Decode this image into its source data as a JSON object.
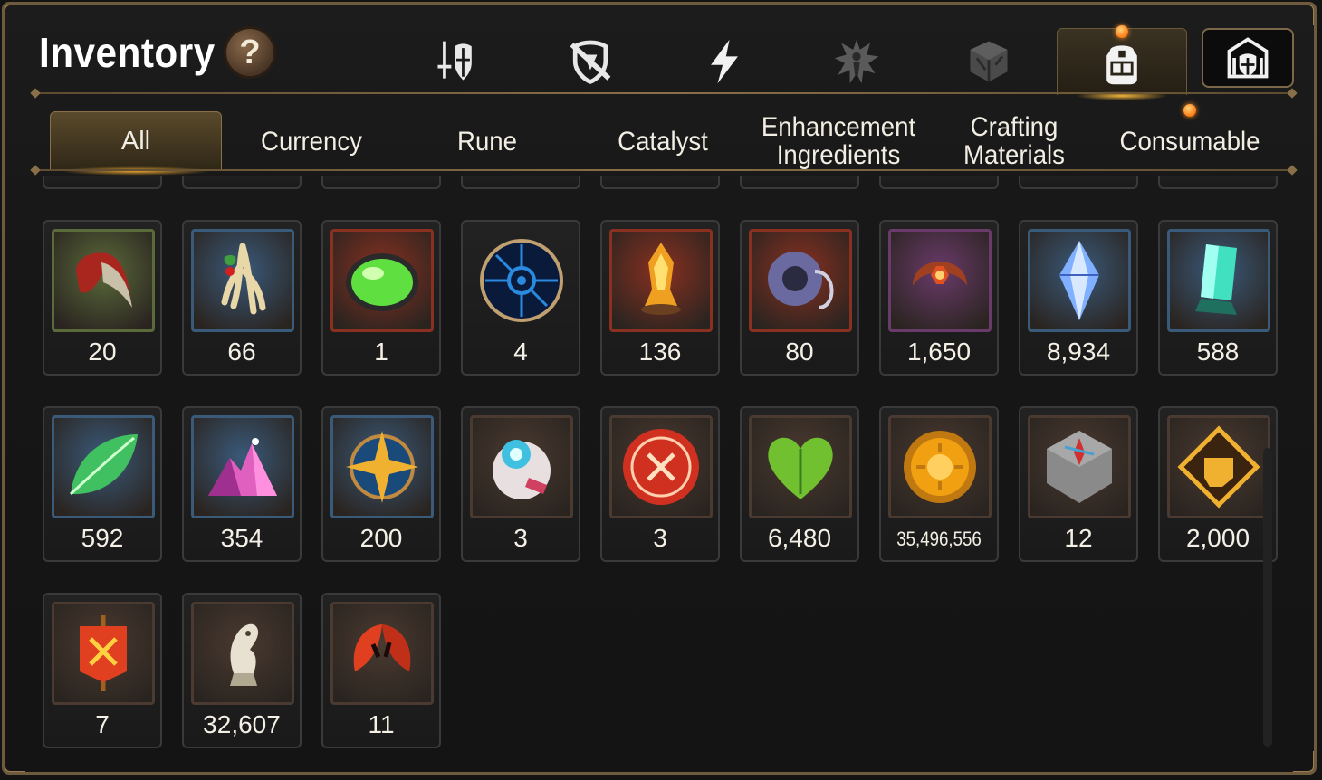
{
  "header": {
    "title": "Inventory",
    "help_label": "?"
  },
  "category_tabs": [
    {
      "icon": "sword-shield-icon",
      "active": false
    },
    {
      "icon": "broken-shield-icon",
      "active": false
    },
    {
      "icon": "lightning-icon",
      "active": false
    },
    {
      "icon": "splat-figure-icon",
      "active": false
    },
    {
      "icon": "cube-icon",
      "active": false
    },
    {
      "icon": "backpack-icon",
      "active": true
    },
    {
      "icon": "castle-shield-icon",
      "active": false
    }
  ],
  "sub_tabs": [
    {
      "label": "All",
      "active": true
    },
    {
      "label": "Currency",
      "active": false
    },
    {
      "label": "Rune",
      "active": false
    },
    {
      "label": "Catalyst",
      "active": false
    },
    {
      "label": "Enhancement Ingredients",
      "active": false
    },
    {
      "label": "Crafting Materials",
      "active": false
    },
    {
      "label": "Consumable",
      "active": false
    }
  ],
  "items": [
    {
      "icon": "claw-icon",
      "quantity": "20",
      "frame": "#5a6a3a",
      "color": "#c8c0a8"
    },
    {
      "icon": "root-herb-icon",
      "quantity": "66",
      "frame": "#3a5a7a",
      "color": "#e8d8a8"
    },
    {
      "icon": "green-orb-icon",
      "quantity": "1",
      "frame": "#8a3020",
      "color": "#60e040"
    },
    {
      "icon": "blue-rune-disc-icon",
      "quantity": "4",
      "frame": "round",
      "color": "#2a8ae0"
    },
    {
      "icon": "flame-crystal-icon",
      "quantity": "136",
      "frame": "#8a3020",
      "color": "#f0a020"
    },
    {
      "icon": "ring-charm-icon",
      "quantity": "80",
      "frame": "#8a3020",
      "color": "#6a6aa0"
    },
    {
      "icon": "crescent-flower-icon",
      "quantity": "1,650",
      "frame": "#6a3a6a",
      "color": "#e05020"
    },
    {
      "icon": "blue-crystal-icon",
      "quantity": "8,934",
      "frame": "#3a5a7a",
      "color": "#80b0ff"
    },
    {
      "icon": "teal-crystal-icon",
      "quantity": "588",
      "frame": "#3a5a7a",
      "color": "#40e0c0"
    },
    {
      "icon": "green-leaf-icon",
      "quantity": "592",
      "frame": "#3a5a7a",
      "color": "#40c060"
    },
    {
      "icon": "pink-crystal-pile-icon",
      "quantity": "354",
      "frame": "#3a5a7a",
      "color": "#e060c0"
    },
    {
      "icon": "star-compass-icon",
      "quantity": "200",
      "frame": "#3a5a7a",
      "color": "#f0b030"
    },
    {
      "icon": "orb-device-icon",
      "quantity": "3",
      "frame": "#4a3a30",
      "color": "#40c0e0"
    },
    {
      "icon": "red-badge-icon",
      "quantity": "3",
      "frame": "#4a3a30",
      "color": "#d03020"
    },
    {
      "icon": "green-heart-icon",
      "quantity": "6,480",
      "frame": "#4a3a30",
      "color": "#70c030"
    },
    {
      "icon": "gold-coin-icon",
      "quantity": "35,496,556",
      "frame": "#4a3a30",
      "color": "#f0a010"
    },
    {
      "icon": "stone-compass-icon",
      "quantity": "12",
      "frame": "#4a3a30",
      "color": "#8a8a8a"
    },
    {
      "icon": "fist-emblem-icon",
      "quantity": "2,000",
      "frame": "#4a3a30",
      "color": "#f0b030"
    },
    {
      "icon": "war-banner-icon",
      "quantity": "7",
      "frame": "#4a3a30",
      "color": "#e04020"
    },
    {
      "icon": "chess-knight-icon",
      "quantity": "32,607",
      "frame": "#4a3a30",
      "color": "#e8e0d0"
    },
    {
      "icon": "red-leaves-icon",
      "quantity": "11",
      "frame": "#4a3a30",
      "color": "#e04020"
    }
  ],
  "colors": {
    "accent_gold": "#8a7048",
    "glow": "#ffb43c",
    "text": "#f4f0e6"
  }
}
